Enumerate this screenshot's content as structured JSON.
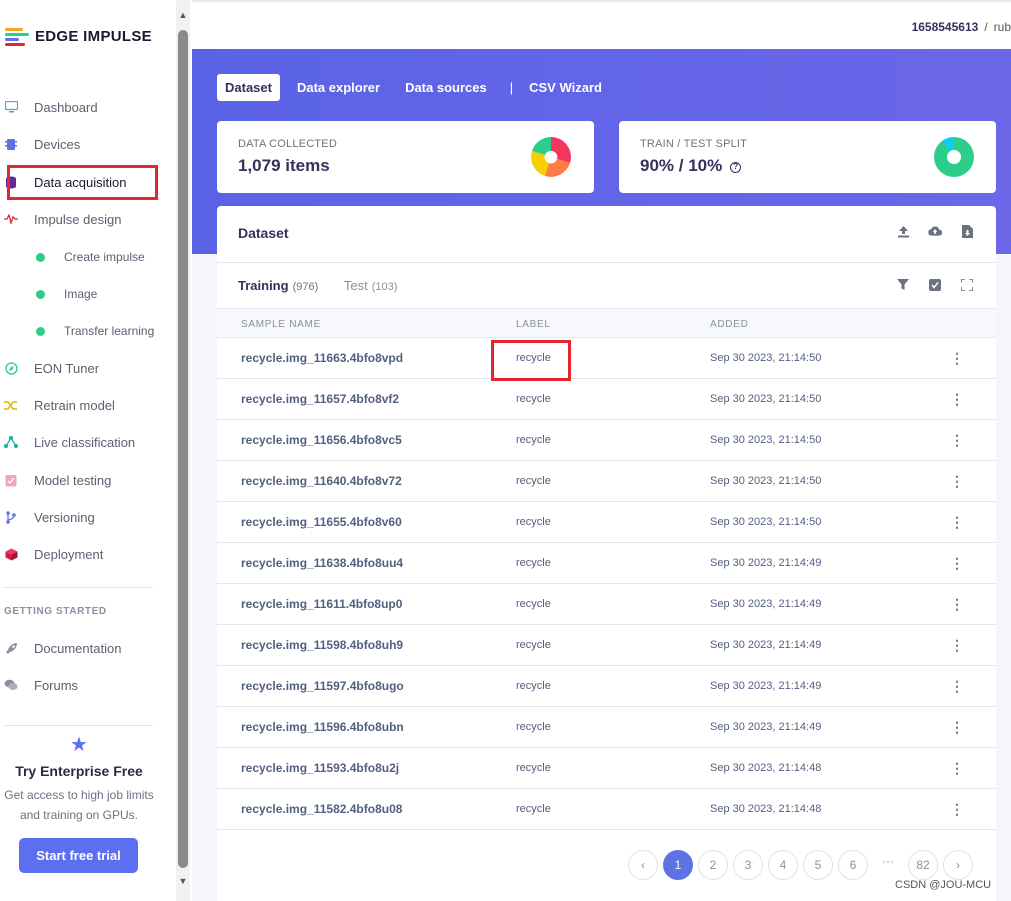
{
  "brand": {
    "name": "EDGE IMPULSE"
  },
  "topbar": {
    "project_id": "1658545613",
    "separator": "/",
    "user": "rub"
  },
  "sidebar": {
    "items": [
      {
        "label": "Dashboard",
        "icon": "monitor-icon"
      },
      {
        "label": "Devices",
        "icon": "chip-icon"
      },
      {
        "label": "Data acquisition",
        "icon": "database-icon"
      },
      {
        "label": "Impulse design",
        "icon": "pulse-icon"
      },
      {
        "label": "Create impulse",
        "icon": "status-dot"
      },
      {
        "label": "Image",
        "icon": "status-dot"
      },
      {
        "label": "Transfer learning",
        "icon": "status-dot"
      },
      {
        "label": "EON Tuner",
        "icon": "compass-icon"
      },
      {
        "label": "Retrain model",
        "icon": "shuffle-icon"
      },
      {
        "label": "Live classification",
        "icon": "network-icon"
      },
      {
        "label": "Model testing",
        "icon": "clipboard-check-icon"
      },
      {
        "label": "Versioning",
        "icon": "branch-icon"
      },
      {
        "label": "Deployment",
        "icon": "box-icon"
      }
    ],
    "section_title": "GETTING STARTED",
    "getting_started": [
      {
        "label": "Documentation",
        "icon": "rocket-icon"
      },
      {
        "label": "Forums",
        "icon": "chat-icon"
      }
    ],
    "enterprise": {
      "title": "Try Enterprise Free",
      "text_line1": "Get access to high job limits",
      "text_line2": "and training on GPUs.",
      "button": "Start free trial"
    }
  },
  "tabs": [
    "Dataset",
    "Data explorer",
    "Data sources",
    "CSV Wizard"
  ],
  "tab_separator": "|",
  "stats": {
    "collected_label": "DATA COLLECTED",
    "collected_value": "1,079 items",
    "split_label": "TRAIN / TEST SPLIT",
    "split_value": "90% / 10%",
    "split_train_fraction": 0.9,
    "help_glyph": "?"
  },
  "dataset": {
    "title": "Dataset",
    "training_label": "Training",
    "training_count": "(976)",
    "test_label": "Test",
    "test_count": "(103)",
    "columns": [
      "SAMPLE NAME",
      "LABEL",
      "ADDED"
    ],
    "rows": [
      {
        "name": "recycle.img_11663.4bfo8vpd",
        "label": "recycle",
        "added": "Sep 30 2023, 21:14:50"
      },
      {
        "name": "recycle.img_11657.4bfo8vf2",
        "label": "recycle",
        "added": "Sep 30 2023, 21:14:50"
      },
      {
        "name": "recycle.img_11656.4bfo8vc5",
        "label": "recycle",
        "added": "Sep 30 2023, 21:14:50"
      },
      {
        "name": "recycle.img_11640.4bfo8v72",
        "label": "recycle",
        "added": "Sep 30 2023, 21:14:50"
      },
      {
        "name": "recycle.img_11655.4bfo8v60",
        "label": "recycle",
        "added": "Sep 30 2023, 21:14:50"
      },
      {
        "name": "recycle.img_11638.4bfo8uu4",
        "label": "recycle",
        "added": "Sep 30 2023, 21:14:49"
      },
      {
        "name": "recycle.img_11611.4bfo8up0",
        "label": "recycle",
        "added": "Sep 30 2023, 21:14:49"
      },
      {
        "name": "recycle.img_11598.4bfo8uh9",
        "label": "recycle",
        "added": "Sep 30 2023, 21:14:49"
      },
      {
        "name": "recycle.img_11597.4bfo8ugo",
        "label": "recycle",
        "added": "Sep 30 2023, 21:14:49"
      },
      {
        "name": "recycle.img_11596.4bfo8ubn",
        "label": "recycle",
        "added": "Sep 30 2023, 21:14:49"
      },
      {
        "name": "recycle.img_11593.4bfo8u2j",
        "label": "recycle",
        "added": "Sep 30 2023, 21:14:48"
      },
      {
        "name": "recycle.img_11582.4bfo8u08",
        "label": "recycle",
        "added": "Sep 30 2023, 21:14:48"
      }
    ],
    "row_menu_glyph": "⋮"
  },
  "pagination": {
    "prev": "‹",
    "pages": [
      "1",
      "2",
      "3",
      "4",
      "5",
      "6"
    ],
    "ellipsis": "···",
    "last": "82",
    "next": "›",
    "current": "1"
  },
  "watermark": "CSDN @JOU-MCU",
  "colors": {
    "accent": "#5e72e4",
    "highlight": "#e3262f",
    "success": "#2dce89",
    "banner": "#5a63e6"
  }
}
